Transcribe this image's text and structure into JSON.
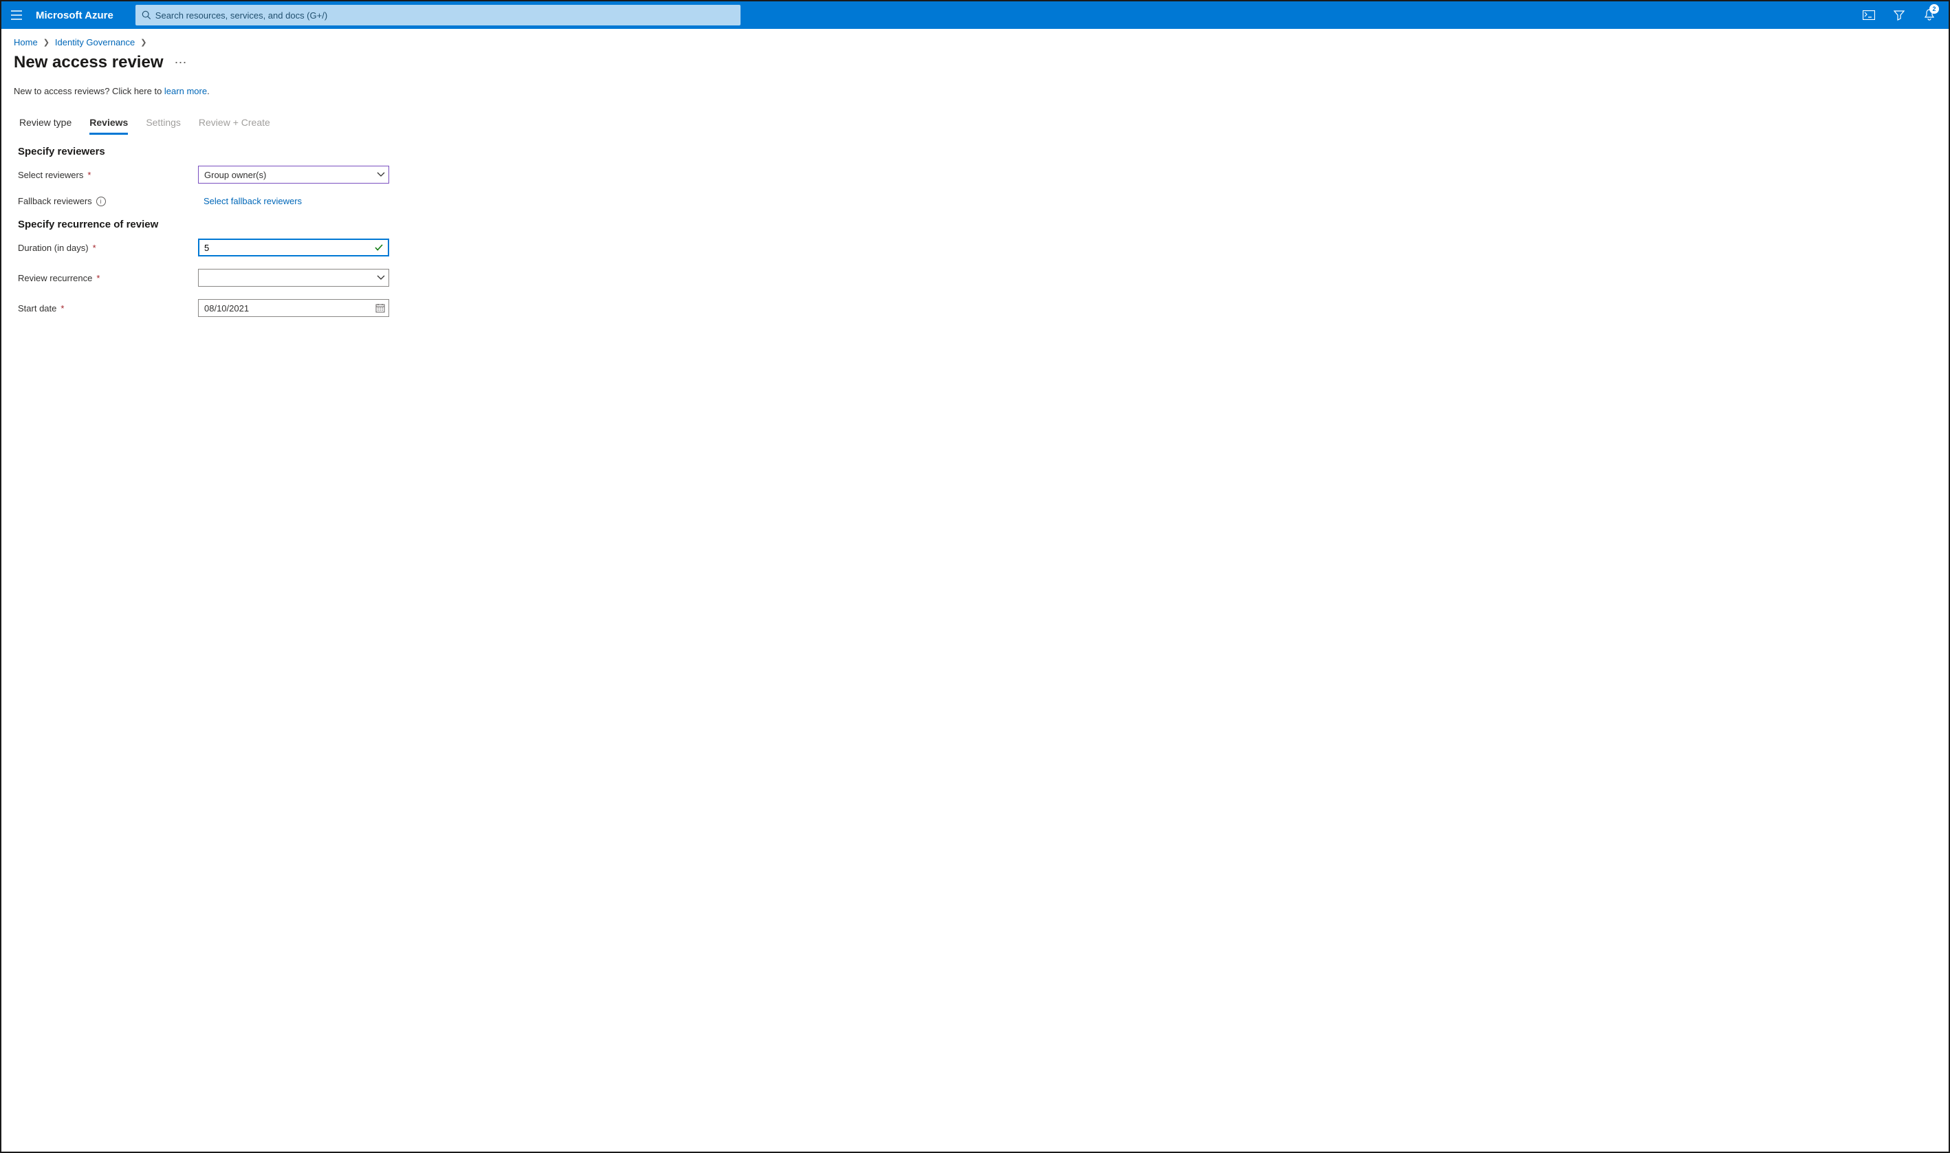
{
  "header": {
    "brand": "Microsoft Azure",
    "search_placeholder": "Search resources, services, and docs (G+/)",
    "notification_count": "2"
  },
  "breadcrumb": {
    "home": "Home",
    "identity_governance": "Identity Governance"
  },
  "page": {
    "title": "New access review",
    "intro_prefix": "New to access reviews? Click here to ",
    "intro_link": "learn more",
    "intro_suffix": "."
  },
  "tabs": {
    "review_type": "Review type",
    "reviews": "Reviews",
    "settings": "Settings",
    "review_create": "Review + Create"
  },
  "sections": {
    "specify_reviewers": "Specify reviewers",
    "specify_recurrence": "Specify recurrence of review"
  },
  "fields": {
    "select_reviewers_label": "Select reviewers",
    "select_reviewers_value": "Group owner(s)",
    "fallback_reviewers_label": "Fallback reviewers",
    "fallback_reviewers_action": "Select fallback reviewers",
    "duration_label": "Duration (in days)",
    "duration_value": "5",
    "recurrence_label": "Review recurrence",
    "recurrence_value": "",
    "start_date_label": "Start date",
    "start_date_value": "08/10/2021"
  }
}
